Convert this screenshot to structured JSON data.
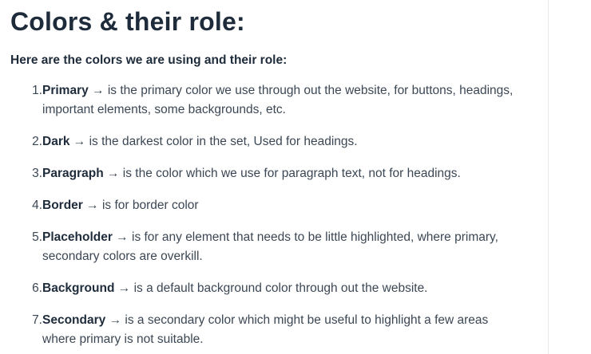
{
  "heading": "Colors & their role:",
  "intro": "Here are the colors we are using and their role:",
  "items": [
    {
      "number": "1.",
      "term": "Primary",
      "arrow": " → ",
      "desc": "is the primary color we use through out the website, for buttons, headings, important elements, some backgrounds, etc."
    },
    {
      "number": "2.",
      "term": "Dark",
      "arrow": " → ",
      "desc": "is the darkest color in the set, Used for headings."
    },
    {
      "number": "3.",
      "term": "Paragraph",
      "arrow": " → ",
      "desc": "is the color which we use for paragraph text, not for headings."
    },
    {
      "number": "4.",
      "term": "Border",
      "arrow": " → ",
      "desc": "is for border color"
    },
    {
      "number": "5.",
      "term": "Placeholder",
      "arrow": " → ",
      "desc": "is for any element that needs to be little highlighted, where primary, secondary colors are overkill."
    },
    {
      "number": "6.",
      "term": "Background",
      "arrow": " → ",
      "desc": "is a default background color through out the website."
    },
    {
      "number": "7.",
      "term": "Secondary",
      "arrow": " → ",
      "desc": "is a secondary color which might be useful to highlight a few areas where primary is not suitable."
    }
  ]
}
